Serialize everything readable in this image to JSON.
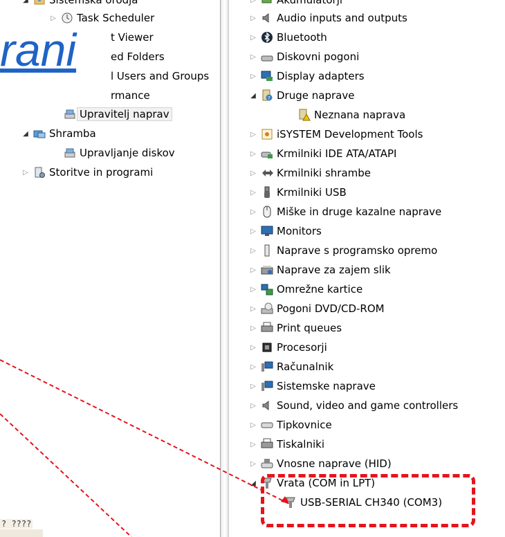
{
  "left_tree": {
    "items": [
      {
        "label": "Sistemska orodja",
        "icon": "tools-folder-icon",
        "expander": "open"
      },
      {
        "label": "Task Scheduler",
        "icon": "clock-icon",
        "expander": "closed"
      },
      {
        "label": "t Viewer",
        "icon": "event-viewer-icon",
        "expander": ""
      },
      {
        "label": "ed Folders",
        "icon": "shared-folder-icon",
        "expander": ""
      },
      {
        "label": "l Users and Groups",
        "icon": "users-icon",
        "expander": ""
      },
      {
        "label": "rmance",
        "icon": "performance-icon",
        "expander": ""
      },
      {
        "label": "Upravitelj naprav",
        "icon": "device-manager-icon",
        "expander": ""
      },
      {
        "label": "Shramba",
        "icon": "storage-icon",
        "expander": "open"
      },
      {
        "label": "Upravljanje diskov",
        "icon": "disk-management-icon",
        "expander": ""
      },
      {
        "label": "Storitve in programi",
        "icon": "services-icon",
        "expander": "closed"
      }
    ]
  },
  "right_tree": {
    "items": [
      {
        "label": "Akumulatorji",
        "icon": "battery-icon",
        "expander": "closed"
      },
      {
        "label": "Audio inputs and outputs",
        "icon": "speaker-icon",
        "expander": "closed"
      },
      {
        "label": "Bluetooth",
        "icon": "bluetooth-icon",
        "expander": "closed"
      },
      {
        "label": "Diskovni pogoni",
        "icon": "disk-drive-icon",
        "expander": "closed"
      },
      {
        "label": "Display adapters",
        "icon": "display-adapter-icon",
        "expander": "closed"
      },
      {
        "label": "Druge naprave",
        "icon": "unknown-device-icon",
        "expander": "open"
      },
      {
        "label": "Neznana naprava",
        "icon": "warning-device-icon",
        "expander": ""
      },
      {
        "label": "iSYSTEM Development Tools",
        "icon": "dev-tools-icon",
        "expander": "closed"
      },
      {
        "label": "Krmilniki IDE ATA/ATAPI",
        "icon": "ide-controller-icon",
        "expander": "closed"
      },
      {
        "label": "Krmilniki shrambe",
        "icon": "storage-controller-icon",
        "expander": "closed"
      },
      {
        "label": "Krmilniki USB",
        "icon": "usb-icon",
        "expander": "closed"
      },
      {
        "label": "Miške in druge kazalne naprave",
        "icon": "mouse-icon",
        "expander": "closed"
      },
      {
        "label": "Monitors",
        "icon": "monitor-icon",
        "expander": "closed"
      },
      {
        "label": "Naprave s programsko opremo",
        "icon": "software-device-icon",
        "expander": "closed"
      },
      {
        "label": "Naprave za zajem slik",
        "icon": "scanner-icon",
        "expander": "closed"
      },
      {
        "label": "Omrežne kartice",
        "icon": "network-adapter-icon",
        "expander": "closed"
      },
      {
        "label": "Pogoni DVD/CD-ROM",
        "icon": "dvd-drive-icon",
        "expander": "closed"
      },
      {
        "label": "Print queues",
        "icon": "printer-icon",
        "expander": "closed"
      },
      {
        "label": "Procesorji",
        "icon": "processor-icon",
        "expander": "closed"
      },
      {
        "label": "Računalnik",
        "icon": "computer-icon",
        "expander": "closed"
      },
      {
        "label": "Sistemske naprave",
        "icon": "system-devices-icon",
        "expander": "closed"
      },
      {
        "label": "Sound, video and game controllers",
        "icon": "sound-icon",
        "expander": "closed"
      },
      {
        "label": "Tipkovnice",
        "icon": "keyboard-icon",
        "expander": "closed"
      },
      {
        "label": "Tiskalniki",
        "icon": "printer-icon",
        "expander": "closed"
      },
      {
        "label": "Vnosne naprave (HID)",
        "icon": "hid-icon",
        "expander": "closed"
      },
      {
        "label": "Vrata (COM in LPT)",
        "icon": "port-icon",
        "expander": "open"
      },
      {
        "label": "USB-SERIAL CH340 (COM3)",
        "icon": "port-icon",
        "expander": ""
      }
    ]
  },
  "overlay": {
    "word": "rani",
    "garbled": "? ????"
  },
  "colors": {
    "annotation": "#e4141b",
    "link_blue": "#1f63c6",
    "selection_bg": "#f2f2f2"
  }
}
